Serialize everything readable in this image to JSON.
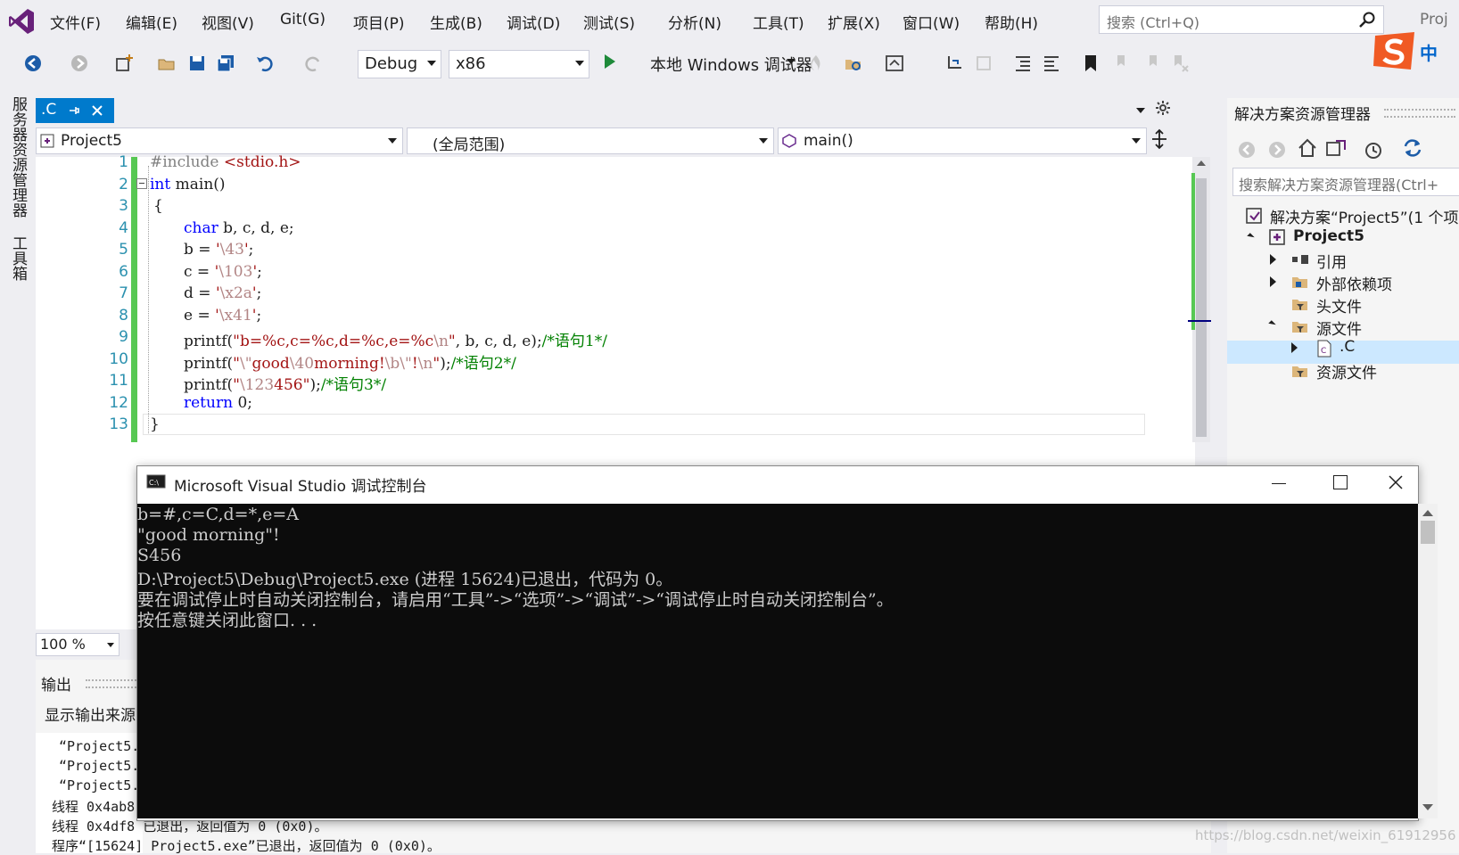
{
  "menu": {
    "items": [
      "文件(F)",
      "编辑(E)",
      "视图(V)",
      "Git(G)",
      "项目(P)",
      "生成(B)",
      "调试(D)",
      "测试(S)",
      "分析(N)",
      "工具(T)",
      "扩展(X)",
      "窗口(W)",
      "帮助(H)"
    ],
    "search_placeholder": "搜索 (Ctrl+Q)",
    "project_tab": "Proj"
  },
  "toolbar": {
    "config": "Debug",
    "platform": "x86",
    "run_label": "本地 Windows 调试器"
  },
  "left_tabs": [
    "服务器资源管理器",
    "工具箱"
  ],
  "editor": {
    "file_tab": ".C",
    "project_combo": "Project5",
    "scope_combo": "(全局范围)",
    "member_combo": "main()",
    "line_numbers": [
      "1",
      "2",
      "3",
      "4",
      "5",
      "6",
      "7",
      "8",
      "9",
      "10",
      "11",
      "12",
      "13"
    ],
    "zoom": "100 %"
  },
  "output": {
    "title": "输出",
    "source_label": "显示输出来源",
    "lines": [
      "“Project5.",
      "“Project5.",
      "“Project5.",
      "线程 0x4ab8",
      "线程 0x4df8 已退出，返回值为 0 (0x0)。",
      "程序“[15624] Project5.exe”已退出，返回值为 0 (0x0)。"
    ]
  },
  "solution_explorer": {
    "title": "解决方案资源管理器",
    "search_placeholder": "搜索解决方案资源管理器(Ctrl+",
    "solution": "解决方案“Project5”(1 个项",
    "project": "Project5",
    "nodes": [
      "引用",
      "外部依赖项",
      "头文件",
      "源文件",
      ".C",
      "资源文件"
    ]
  },
  "console": {
    "title": "Microsoft Visual Studio 调试控制台",
    "lines": [
      "b=#,c=C,d=*,e=A",
      "\"good morning\"!",
      "S456",
      "D:\\Project5\\Debug\\Project5.exe (进程 15624)已退出，代码为 0。",
      "要在调试停止时自动关闭控制台，请启用“工具”->“选项”->“调试”->“调试停止时自动关闭控制台”。",
      "按任意键关闭此窗口. . ."
    ]
  },
  "ime": {
    "label": "中"
  },
  "watermark": "https://blog.csdn.net/weixin_61912956"
}
